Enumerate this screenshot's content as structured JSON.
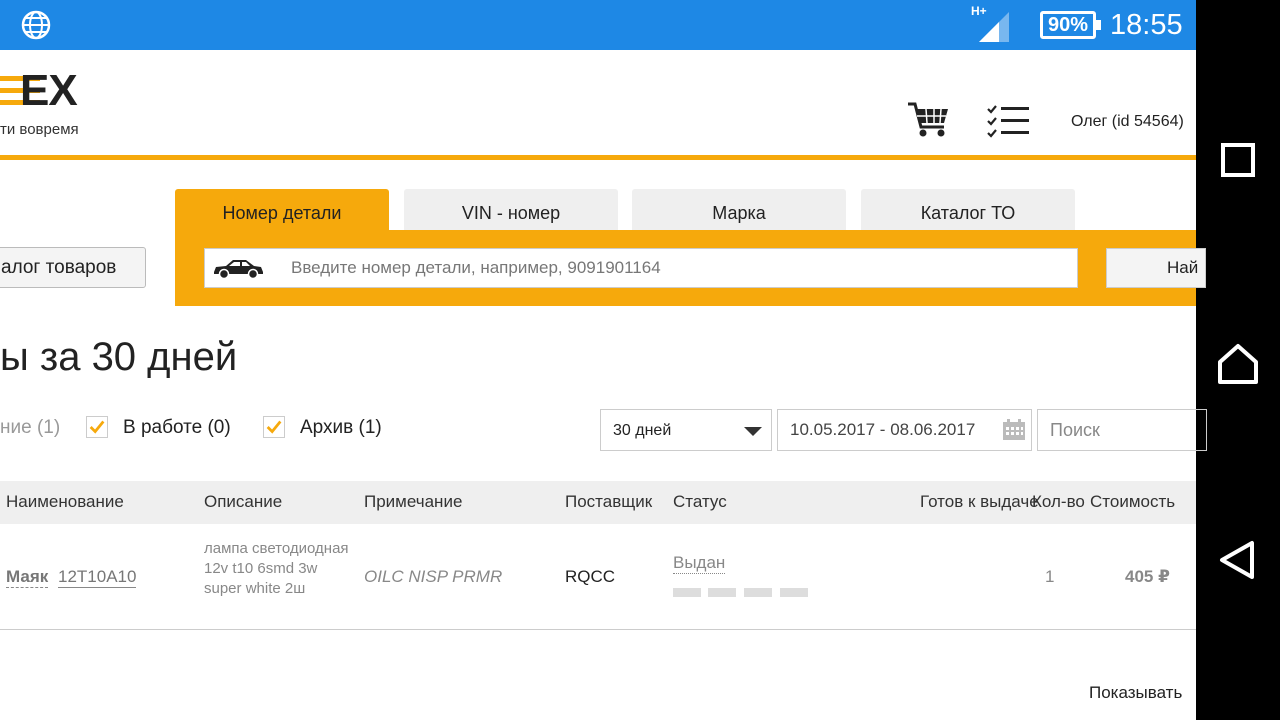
{
  "status_bar": {
    "network_type": "H+",
    "battery": "90%",
    "time": "18:55"
  },
  "header": {
    "logo": "EX",
    "slogan": "ти вовремя",
    "user": "Олег   (id 54564)"
  },
  "search": {
    "tabs": [
      "Номер детали",
      "VIN - номер",
      "Марка",
      "Каталог ТО"
    ],
    "placeholder": "Введите номер детали, например, 9091901164",
    "find_button": "Най",
    "catalog_button": "алог товаров"
  },
  "page": {
    "title": "ы за 30 дней",
    "filters": [
      "ние (1)",
      "В работе (0)",
      "Архив (1)"
    ],
    "period_select": "30 дней",
    "date_range": "10.05.2017 - 08.06.2017",
    "search_placeholder": "Поиск"
  },
  "table": {
    "headers": [
      "Наименование",
      "Описание",
      "Примечание",
      "Поставщик",
      "Статус",
      "Готов к выдаче",
      "Кол-во",
      "Стоимость"
    ],
    "rows": [
      {
        "brand": "Маяк",
        "part_no": "12T10A10",
        "description": "лампа светодиодная 12v t10 6smd 3w super white 2ш",
        "note": "OILC NISP PRMR",
        "supplier": "RQCC",
        "status": "Выдан",
        "qty": "1",
        "cost": "405 ₽"
      }
    ]
  },
  "footer": {
    "show_label": "Показывать"
  },
  "colors": {
    "accent": "#f6a90c",
    "status_bar": "#1e88e5"
  }
}
